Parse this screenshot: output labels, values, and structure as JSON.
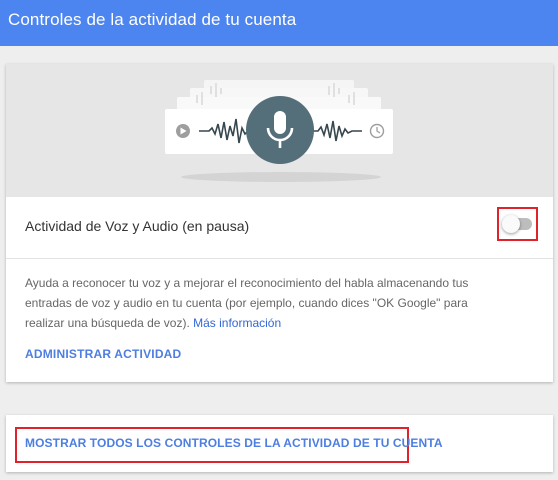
{
  "header": {
    "title": "Controles de la actividad de tu cuenta"
  },
  "voice_card": {
    "illustration": {
      "icons": [
        "play-icon",
        "microphone-icon",
        "clock-icon"
      ],
      "mic_circle_color": "#546e7a"
    },
    "setting_label": "Actividad de Voz y Audio (en pausa)",
    "toggle_on": false,
    "description": "Ayuda a reconocer tu voz y a mejorar el reconocimiento del habla almacenando tus entradas de voz y audio en tu cuenta (por ejemplo, cuando dices \"OK Google\" para realizar una búsqueda de voz).",
    "more_info_link": "Más información",
    "manage_link": "ADMINISTRAR ACTIVIDAD"
  },
  "bottom_card": {
    "show_all_link": "MOSTRAR TODOS LOS CONTROLES DE LA ACTIVIDAD DE TU CUENTA"
  },
  "colors": {
    "header_bg": "#4d85f0",
    "link": "#4d7ee0",
    "highlight": "#e0232a"
  }
}
